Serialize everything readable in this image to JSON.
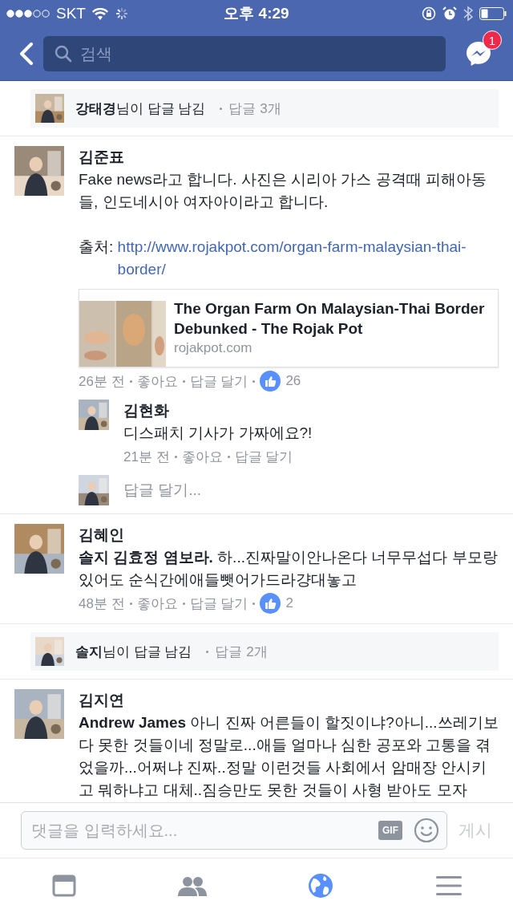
{
  "status_bar": {
    "carrier": "SKT",
    "time": "오후 4:29"
  },
  "nav": {
    "search": {
      "placeholder": "검색"
    },
    "messenger_badge": "1"
  },
  "thread": [
    {
      "kind": "reply_summary",
      "name": "강태경",
      "text": "님이 답글 남김",
      "count": "답글 3개"
    },
    {
      "kind": "comment",
      "name": "김준표",
      "paragraphs": [
        {
          "text": "Fake news라고 합니다. 사진은 시리아 가스 공격때 피해아동들, 인도네시아 여자아이라고 합니다."
        },
        {
          "prefix": "출처: ",
          "link": "http://www.rojakpot.com/organ-farm-malaysian-thai-border/"
        }
      ],
      "preview": {
        "title": "The Organ Farm On Malaysian-Thai Border Debunked - The Rojak Pot",
        "domain": "rojakpot.com"
      },
      "meta": {
        "time": "26분 전",
        "like": "좋아요",
        "reply": "답글 달기",
        "likes": "26"
      },
      "replies": [
        {
          "name": "김현화",
          "text": "디스패치 기사가 가짜에요?!",
          "meta": {
            "time": "21분 전",
            "like": "좋아요",
            "reply": "답글 달기"
          }
        }
      ],
      "reply_prompt": "답글 달기..."
    },
    {
      "kind": "comment",
      "name": "김혜인",
      "paragraphs": [
        {
          "text": "**솔지 김효정 염보라.** 하...진짜말이안나온다 너무무섭다 부모랑있어도 순식간에애들뺏어가드라걍대놓고"
        }
      ],
      "meta": {
        "time": "48분 전",
        "like": "좋아요",
        "reply": "답글 달기",
        "likes": "2"
      }
    },
    {
      "kind": "reply_summary",
      "name": "솔지",
      "text": "님이 답글 남김",
      "count": "답글 2개"
    },
    {
      "kind": "comment",
      "name": "김지연",
      "paragraphs": [
        {
          "text": "**Andrew James** 아니 진짜 어른들이 할짓이냐?아니...쓰레기보다 못한 것들이네 정말로...애들 얼마나 심한 공포와 고통을 겪었을까...어쩌냐 진짜..정말 이런것들 사회에서 암매장 안시키고 뭐하냐고 대체..짐승만도 못한 것들이 사형 받아도 모자"
        }
      ]
    }
  ],
  "composer": {
    "placeholder": "댓글을 입력하세요...",
    "gif": "GIF",
    "post": "게시"
  },
  "tabs": [
    {
      "kind": "feed",
      "selected": false
    },
    {
      "kind": "friends",
      "selected": false
    },
    {
      "kind": "globe",
      "selected": true
    },
    {
      "kind": "menu",
      "selected": false
    }
  ]
}
